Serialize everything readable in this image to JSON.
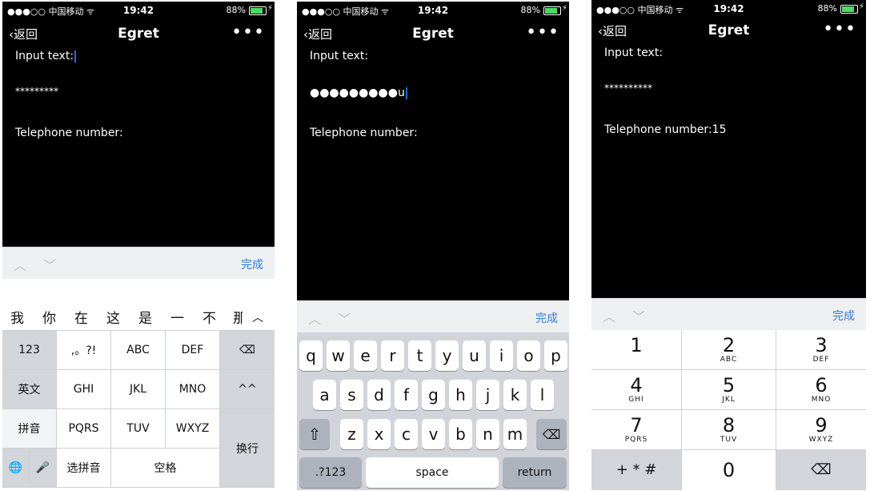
{
  "status_bar": {
    "carrier": "●●●○○ 中国移动 ᯤ",
    "time": "19:42",
    "battery": "88%"
  },
  "nav": {
    "back_label": "返回",
    "title": "Egret",
    "more": "•••"
  },
  "screens": [
    {
      "input_label": "Input text:",
      "password_value": "*********",
      "phone_label": "Telephone number:"
    },
    {
      "input_label": "Input text:",
      "password_value": "●●●●●●●●●u",
      "phone_label": "Telephone number:"
    },
    {
      "input_label": "Input text:",
      "password_value": "**********",
      "phone_label": "Telephone number:15"
    }
  ],
  "accessory": {
    "arrows": "︿ ﹀",
    "done": "完成"
  },
  "chinese_keyboard": {
    "candidates": [
      "我",
      "你",
      "在",
      "这",
      "是",
      "一",
      "不",
      "那"
    ],
    "collapse": "︿",
    "keys": {
      "k123": "123",
      "punct": ",。?!",
      "abc": "ABC",
      "def": "DEF",
      "delete": "⌫",
      "english": "英文",
      "ghi": "GHI",
      "jkl": "JKL",
      "mno": "MNO",
      "face": "^^",
      "pinyin": "拼音",
      "pqrs": "PQRS",
      "tuv": "TUV",
      "wxyz": "WXYZ",
      "enter": "换行",
      "globe": "🌐",
      "mic": "🎤",
      "select_pinyin": "选拼音",
      "space": "空格"
    }
  },
  "qwerty_keyboard": {
    "row1": [
      "q",
      "w",
      "e",
      "r",
      "t",
      "y",
      "u",
      "i",
      "o",
      "p"
    ],
    "row2": [
      "a",
      "s",
      "d",
      "f",
      "g",
      "h",
      "j",
      "k",
      "l"
    ],
    "row3": [
      "z",
      "x",
      "c",
      "v",
      "b",
      "n",
      "m"
    ],
    "shift": "⇧",
    "delete": "⌫",
    "numbers": ".?123",
    "space": "space",
    "return": "return"
  },
  "number_pad": {
    "keys": [
      {
        "n": "1",
        "l": ""
      },
      {
        "n": "2",
        "l": "ABC"
      },
      {
        "n": "3",
        "l": "DEF"
      },
      {
        "n": "4",
        "l": "GHI"
      },
      {
        "n": "5",
        "l": "JKL"
      },
      {
        "n": "6",
        "l": "MNO"
      },
      {
        "n": "7",
        "l": "PQRS"
      },
      {
        "n": "8",
        "l": "TUV"
      },
      {
        "n": "9",
        "l": "WXYZ"
      }
    ],
    "symbols": "+ * #",
    "zero": "0",
    "delete": "⌫"
  }
}
